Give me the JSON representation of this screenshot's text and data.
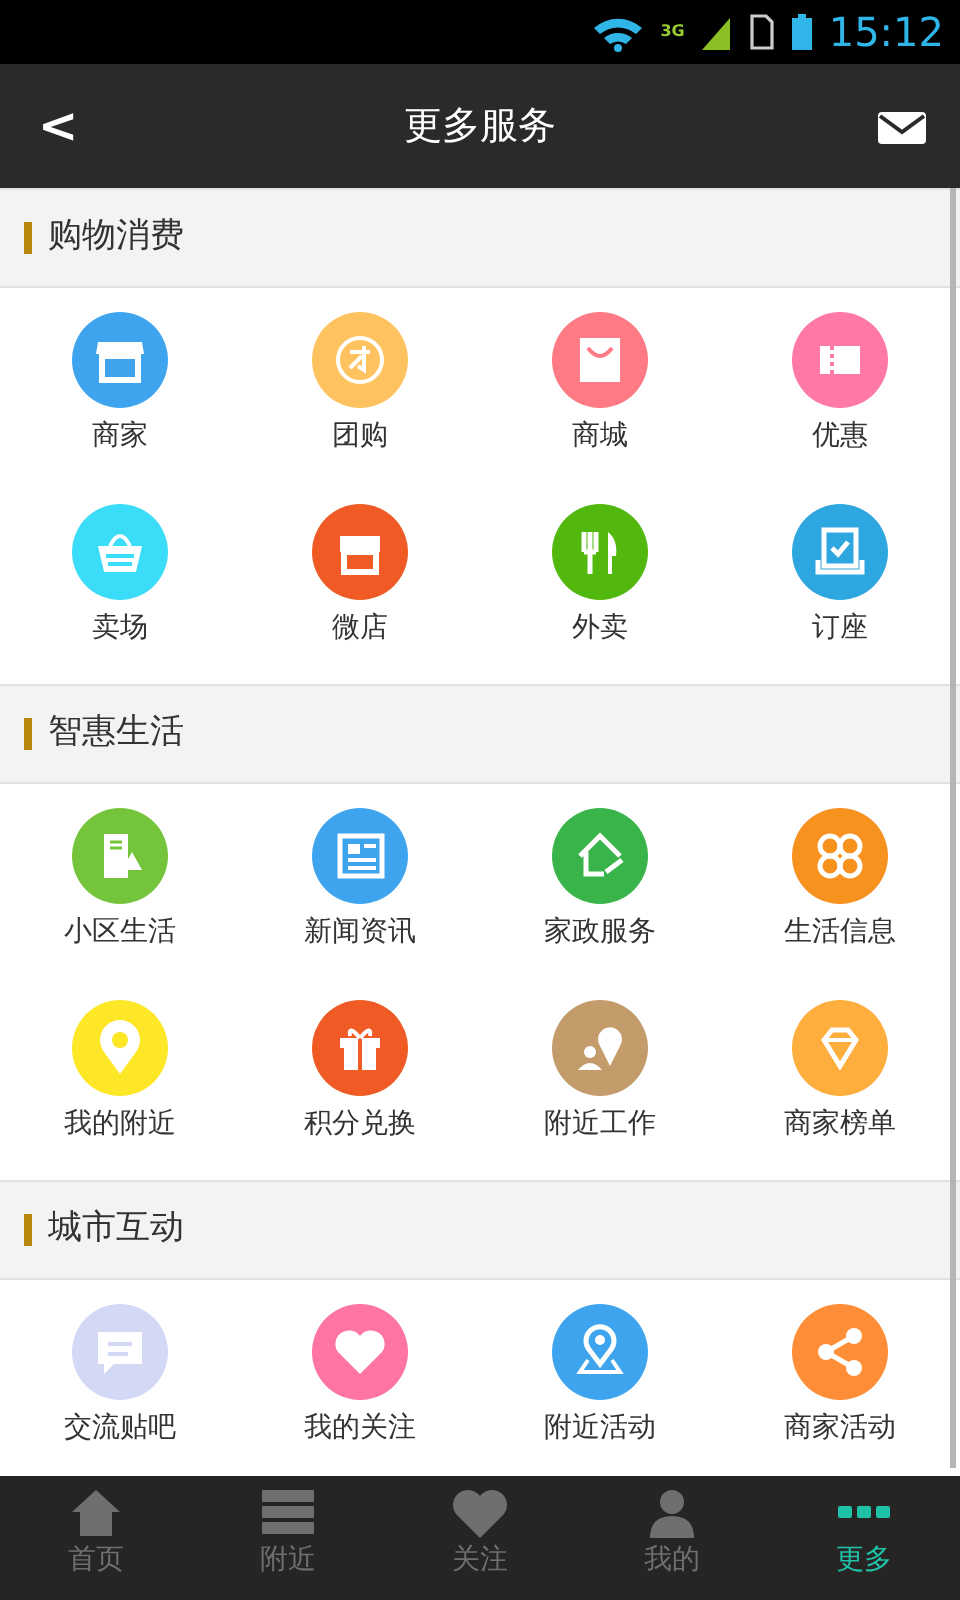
{
  "status_bar": {
    "time": "15:12",
    "network": "3G"
  },
  "header": {
    "back": "<",
    "title": "更多服务"
  },
  "sections": [
    {
      "title": "购物消费",
      "items": [
        {
          "label": "商家",
          "color": "#3fa4ee"
        },
        {
          "label": "团购",
          "color": "#fec35f"
        },
        {
          "label": "商城",
          "color": "#fe7b85"
        },
        {
          "label": "优惠",
          "color": "#fe79a8"
        },
        {
          "label": "卖场",
          "color": "#3bdcf8"
        },
        {
          "label": "微店",
          "color": "#f05a25"
        },
        {
          "label": "外卖",
          "color": "#52b80e"
        },
        {
          "label": "订座",
          "color": "#2ea6df"
        }
      ]
    },
    {
      "title": "智惠生活",
      "items": [
        {
          "label": "小区生活",
          "color": "#74c53b"
        },
        {
          "label": "新闻资讯",
          "color": "#3fa4ee"
        },
        {
          "label": "家政服务",
          "color": "#38b44a"
        },
        {
          "label": "生活信息",
          "color": "#f7921e"
        },
        {
          "label": "我的附近",
          "color": "#fde726"
        },
        {
          "label": "积分兑换",
          "color": "#f05a25"
        },
        {
          "label": "附近工作",
          "color": "#c49b6a"
        },
        {
          "label": "商家榜单",
          "color": "#fdae3c"
        }
      ]
    },
    {
      "title": "城市互动",
      "items": [
        {
          "label": "交流贴吧",
          "color": "#d3d8f4"
        },
        {
          "label": "我的关注",
          "color": "#fe75a3"
        },
        {
          "label": "附近活动",
          "color": "#3fa4ee"
        },
        {
          "label": "商家活动",
          "color": "#fd8e37"
        }
      ]
    }
  ],
  "tabs": [
    {
      "label": "首页",
      "selected": false
    },
    {
      "label": "附近",
      "selected": false
    },
    {
      "label": "关注",
      "selected": false
    },
    {
      "label": "我的",
      "selected": false
    },
    {
      "label": "更多",
      "selected": true
    }
  ]
}
